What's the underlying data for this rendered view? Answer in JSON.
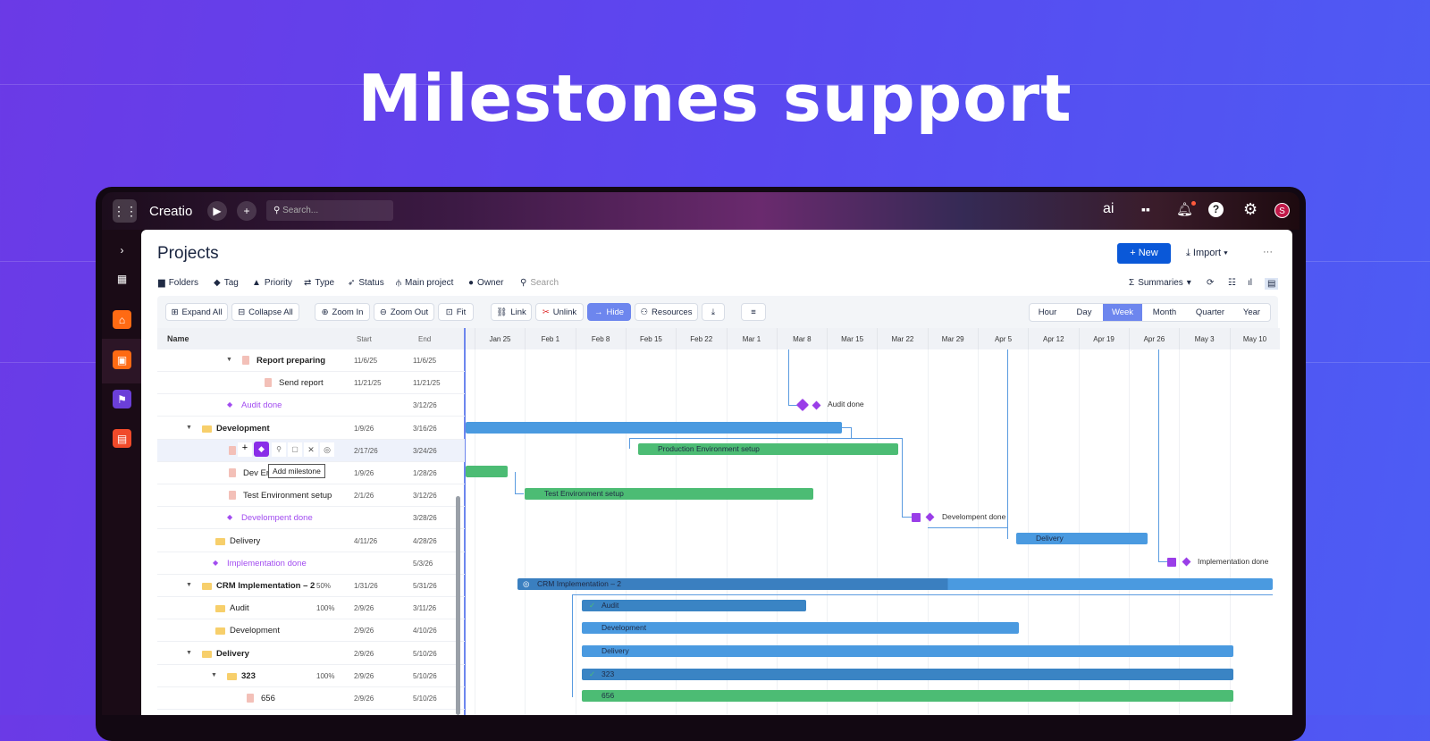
{
  "hero_title": "Milestones support",
  "topbar": {
    "brand": "Creatio",
    "search_placeholder": "Search...",
    "ai_label": "ai",
    "avatar": "S"
  },
  "page": {
    "title": "Projects",
    "new_label": "+ New",
    "import_label": "Import",
    "more": "···"
  },
  "filters": [
    {
      "icon": "folder-icon",
      "label": "Folders"
    },
    {
      "icon": "tag-icon",
      "label": "Tag"
    },
    {
      "icon": "warning-icon",
      "label": "Priority"
    },
    {
      "icon": "type-icon",
      "label": "Type"
    },
    {
      "icon": "rocket-icon",
      "label": "Status"
    },
    {
      "icon": "hierarchy-icon",
      "label": "Main project"
    },
    {
      "icon": "person-icon",
      "label": "Owner"
    }
  ],
  "search_placeholder": "Search",
  "summaries_label": "Summaries",
  "toolbar": {
    "expand_all": "Expand All",
    "collapse_all": "Collapse All",
    "zoom_in": "Zoom In",
    "zoom_out": "Zoom Out",
    "fit": "Fit",
    "link": "Link",
    "unlink": "Unlink",
    "hide": "Hide",
    "resources": "Resources"
  },
  "scales": [
    "Hour",
    "Day",
    "Week",
    "Month",
    "Quarter",
    "Year"
  ],
  "active_scale": "Week",
  "columns": {
    "name": "Name",
    "start": "Start",
    "end": "End"
  },
  "weeks": [
    "Jan 25",
    "Feb 1",
    "Feb 8",
    "Feb 15",
    "Feb 22",
    "Mar 1",
    "Mar 8",
    "Mar 15",
    "Mar 22",
    "Mar 29",
    "Apr 5",
    "Apr 12",
    "Apr 19",
    "Apr 26",
    "May 3",
    "May 10"
  ],
  "rows": [
    {
      "name": "Report preparing",
      "start": "11/6/25",
      "end": "11/6/25",
      "type": "task",
      "bold": true
    },
    {
      "name": "Send report",
      "start": "11/21/25",
      "end": "11/21/25",
      "type": "task"
    },
    {
      "name": "Audit done",
      "start": "",
      "end": "3/12/26",
      "type": "milestone"
    },
    {
      "name": "Development",
      "start": "1/9/26",
      "end": "3/16/26",
      "type": "folder",
      "bold": true
    },
    {
      "name": "P",
      "start": "2/17/26",
      "end": "3/24/26",
      "type": "task"
    },
    {
      "name": "Dev Enviro",
      "start": "1/9/26",
      "end": "1/28/26",
      "type": "task"
    },
    {
      "name": "Test Environment setup",
      "start": "2/1/26",
      "end": "3/12/26",
      "type": "task"
    },
    {
      "name": "Develompent done",
      "start": "",
      "end": "3/28/26",
      "type": "milestone"
    },
    {
      "name": "Delivery",
      "start": "4/11/26",
      "end": "4/28/26",
      "type": "folder"
    },
    {
      "name": "Implementation done",
      "start": "",
      "end": "5/3/26",
      "type": "milestone"
    },
    {
      "name": "CRM Implementation – 2",
      "percent": "50%",
      "start": "1/31/26",
      "end": "5/31/26",
      "type": "folder",
      "bold": true
    },
    {
      "name": "Audit",
      "percent": "100%",
      "start": "2/9/26",
      "end": "3/11/26",
      "type": "folder"
    },
    {
      "name": "Development",
      "start": "2/9/26",
      "end": "4/10/26",
      "type": "folder"
    },
    {
      "name": "Delivery",
      "start": "2/9/26",
      "end": "5/10/26",
      "type": "folder",
      "bold": true
    },
    {
      "name": "323",
      "percent": "100%",
      "start": "2/9/26",
      "end": "5/10/26",
      "type": "folder",
      "bold": true
    },
    {
      "name": "656",
      "start": "2/9/26",
      "end": "5/10/26",
      "type": "task"
    }
  ],
  "tooltip": "Add milestone",
  "bars": {
    "prod": "Production Environment setup",
    "test": "Test Environment setup",
    "delivery": "Delivery",
    "crm": "CRM Implementation – 2",
    "audit": "Audit",
    "dev": "Development",
    "delivery2": "Delivery",
    "b323": "323",
    "b656": "656"
  },
  "milestone_labels": {
    "audit": "Audit done",
    "dev": "Develompent done",
    "impl": "Implementation done"
  },
  "colors": {
    "accent": "#0a58d8",
    "milestone": "#9a3ee8",
    "task_bar": "#4cbc74",
    "project_bar": "#4a9ae0"
  }
}
